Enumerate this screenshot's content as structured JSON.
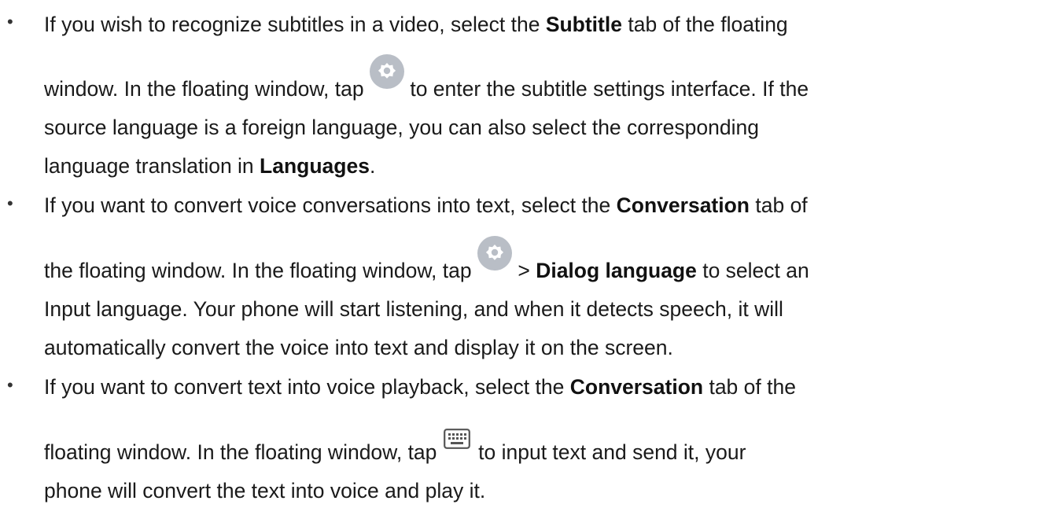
{
  "items": [
    {
      "lines": [
        {
          "parts": [
            "If you wish to recognize subtitles in a video, select the ",
            "Subtitle",
            " tab of the floating"
          ]
        },
        {
          "parts": [
            "window. In the floating window, tap ",
            " to enter the subtitle settings interface. If the"
          ],
          "icon": "gear-icon"
        },
        {
          "parts": [
            "source language is a foreign language, you can also select the corresponding"
          ]
        },
        {
          "parts": [
            "language translation in ",
            "Languages",
            "."
          ]
        }
      ]
    },
    {
      "lines": [
        {
          "parts": [
            "If you want to convert voice conversations into text, select the ",
            "Conversation",
            " tab of"
          ]
        },
        {
          "parts": [
            "the floating window. In the floating window, tap ",
            " > ",
            "Dialog language",
            " to select an"
          ],
          "icon": "gear-icon"
        },
        {
          "parts": [
            "Input language. Your phone will start listening, and when it detects speech, it will"
          ]
        },
        {
          "parts": [
            "automatically convert the voice into text and display it on the screen."
          ]
        }
      ]
    },
    {
      "lines": [
        {
          "parts": [
            "If you want to convert text into voice playback, select the ",
            "Conversation",
            " tab of the"
          ]
        },
        {
          "parts": [
            "floating window. In the floating window, tap ",
            " to input text and send it, your"
          ],
          "icon": "keyboard-icon"
        },
        {
          "parts": [
            "phone will convert the text into voice and play it."
          ]
        }
      ]
    }
  ],
  "bullet_char": "•",
  "colors": {
    "text": "#1a1a1a",
    "icon_bg": "#b9bec6",
    "icon_fg": "#ffffff"
  }
}
